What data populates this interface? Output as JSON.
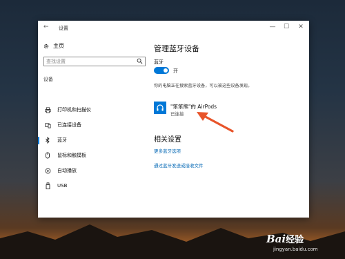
{
  "window": {
    "title": "设置",
    "back_icon": "back-arrow-icon",
    "minimize_icon": "minimize-icon",
    "maximize_icon": "maximize-icon",
    "close_icon": "close-icon"
  },
  "sidebar": {
    "home_label": "主页",
    "search_placeholder": "查找设置",
    "section_label": "设备",
    "items": [
      {
        "label": "打印机和扫描仪",
        "icon": "printer-icon"
      },
      {
        "label": "已连接设备",
        "icon": "connected-devices-icon"
      },
      {
        "label": "蓝牙",
        "icon": "bluetooth-icon",
        "active": true
      },
      {
        "label": "鼠标和触摸板",
        "icon": "mouse-icon"
      },
      {
        "label": "自动播放",
        "icon": "autoplay-icon"
      },
      {
        "label": "USB",
        "icon": "usb-icon"
      }
    ]
  },
  "main": {
    "title": "管理蓝牙设备",
    "bluetooth_label": "蓝牙",
    "toggle_state": "开",
    "status_text": "你的电脑正在搜索蓝牙设备，可以被这些设备发现。",
    "device": {
      "name": "\"笨笨熊\"的 AirPods",
      "state": "已连接",
      "icon": "headphones-icon"
    },
    "related_title": "相关设置",
    "links": [
      "更多蓝牙选项",
      "通过蓝牙发送或接收文件"
    ]
  },
  "watermark": {
    "brand": "Bai",
    "brand_cn": "经验",
    "url": "jingyan.baidu.com"
  },
  "colors": {
    "accent": "#0078d7",
    "link": "#0066b4",
    "arrow": "#e8542a"
  }
}
